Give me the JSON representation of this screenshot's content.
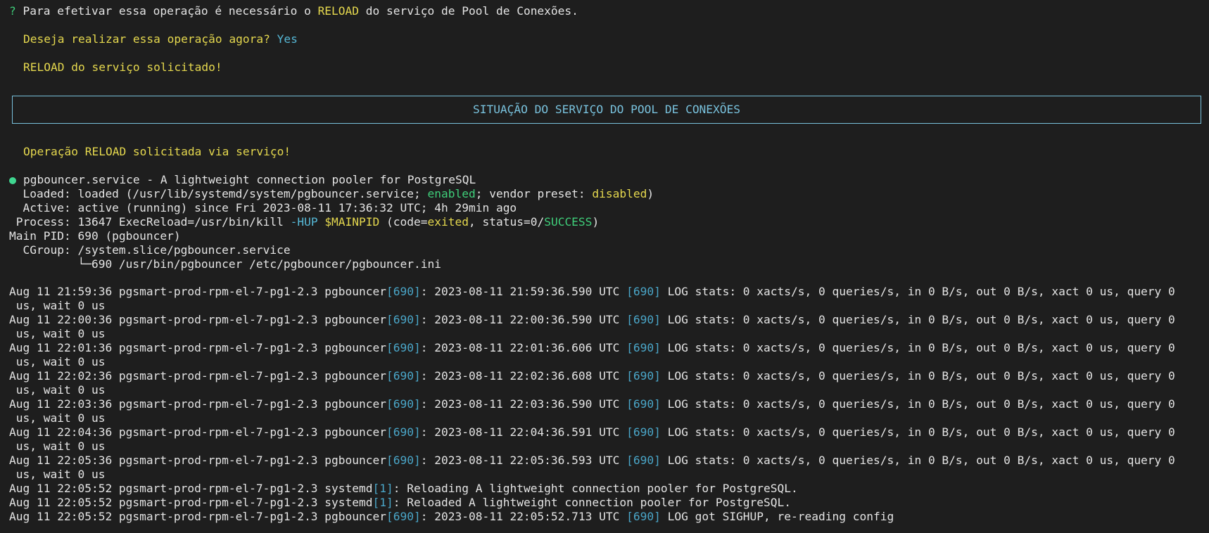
{
  "prompt": {
    "mark": "?",
    "text_before": " Para efetivar essa operação é necessário o ",
    "reload": "RELOAD",
    "text_after": " do serviço de Pool de Conexões."
  },
  "question": {
    "text": "Deseja realizar essa operação agora?",
    "answer": "Yes"
  },
  "reload_requested": "RELOAD do serviço solicitado!",
  "status_box_title": "SITUAÇÃO DO SERVIÇO DO POOL DE CONEXÕES",
  "operation_message": "Operação RELOAD solicitada via serviço!",
  "service": {
    "header": "pgbouncer.service - A lightweight connection pooler for PostgreSQL",
    "loaded_prefix": "  Loaded: loaded (/usr/lib/systemd/system/pgbouncer.service; ",
    "loaded_enabled": "enabled",
    "loaded_mid": "; vendor preset: ",
    "loaded_disabled": "disabled",
    "loaded_suffix": ")",
    "active": "  Active: active (running) since Fri 2023-08-11 17:36:32 UTC; 4h 29min ago",
    "process_prefix": " Process: 13647 ExecReload=/usr/bin/kill ",
    "process_hup": "-HUP",
    "process_space": " ",
    "process_mainpid": "$MAINPID",
    "process_code": " (code=",
    "process_exited": "exited",
    "process_status": ", status=0/",
    "process_success": "SUCCESS",
    "process_end": ")",
    "main_pid": "Main PID: 690 (pgbouncer)",
    "cgroup": "  CGroup: /system.slice/pgbouncer.service",
    "cgroup_child": "          └─690 /usr/bin/pgbouncer /etc/pgbouncer/pgbouncer.ini"
  },
  "logs": [
    {
      "prefix": "Aug 11 21:59:36 pgsmart-prod-rpm-el-7-pg1-2.3 pgbouncer",
      "pid": "[690]",
      "mid": ": 2023-08-11 21:59:36.590 UTC ",
      "pid2": "[690]",
      "msg": " LOG stats: 0 xacts/s, 0 queries/s, in 0 B/s, out 0 B/s, xact 0 us, query 0",
      "wrap": " us, wait 0 us"
    },
    {
      "prefix": "Aug 11 22:00:36 pgsmart-prod-rpm-el-7-pg1-2.3 pgbouncer",
      "pid": "[690]",
      "mid": ": 2023-08-11 22:00:36.590 UTC ",
      "pid2": "[690]",
      "msg": " LOG stats: 0 xacts/s, 0 queries/s, in 0 B/s, out 0 B/s, xact 0 us, query 0",
      "wrap": " us, wait 0 us"
    },
    {
      "prefix": "Aug 11 22:01:36 pgsmart-prod-rpm-el-7-pg1-2.3 pgbouncer",
      "pid": "[690]",
      "mid": ": 2023-08-11 22:01:36.606 UTC ",
      "pid2": "[690]",
      "msg": " LOG stats: 0 xacts/s, 0 queries/s, in 0 B/s, out 0 B/s, xact 0 us, query 0",
      "wrap": " us, wait 0 us"
    },
    {
      "prefix": "Aug 11 22:02:36 pgsmart-prod-rpm-el-7-pg1-2.3 pgbouncer",
      "pid": "[690]",
      "mid": ": 2023-08-11 22:02:36.608 UTC ",
      "pid2": "[690]",
      "msg": " LOG stats: 0 xacts/s, 0 queries/s, in 0 B/s, out 0 B/s, xact 0 us, query 0",
      "wrap": " us, wait 0 us"
    },
    {
      "prefix": "Aug 11 22:03:36 pgsmart-prod-rpm-el-7-pg1-2.3 pgbouncer",
      "pid": "[690]",
      "mid": ": 2023-08-11 22:03:36.590 UTC ",
      "pid2": "[690]",
      "msg": " LOG stats: 0 xacts/s, 0 queries/s, in 0 B/s, out 0 B/s, xact 0 us, query 0",
      "wrap": " us, wait 0 us"
    },
    {
      "prefix": "Aug 11 22:04:36 pgsmart-prod-rpm-el-7-pg1-2.3 pgbouncer",
      "pid": "[690]",
      "mid": ": 2023-08-11 22:04:36.591 UTC ",
      "pid2": "[690]",
      "msg": " LOG stats: 0 xacts/s, 0 queries/s, in 0 B/s, out 0 B/s, xact 0 us, query 0",
      "wrap": " us, wait 0 us"
    },
    {
      "prefix": "Aug 11 22:05:36 pgsmart-prod-rpm-el-7-pg1-2.3 pgbouncer",
      "pid": "[690]",
      "mid": ": 2023-08-11 22:05:36.593 UTC ",
      "pid2": "[690]",
      "msg": " LOG stats: 0 xacts/s, 0 queries/s, in 0 B/s, out 0 B/s, xact 0 us, query 0",
      "wrap": " us, wait 0 us"
    },
    {
      "prefix": "Aug 11 22:05:52 pgsmart-prod-rpm-el-7-pg1-2.3 systemd",
      "pid": "[1]",
      "mid": ": Reloading A lightweight connection pooler for PostgreSQL.",
      "pid2": "",
      "msg": "",
      "wrap": ""
    },
    {
      "prefix": "Aug 11 22:05:52 pgsmart-prod-rpm-el-7-pg1-2.3 systemd",
      "pid": "[1]",
      "mid": ": Reloaded A lightweight connection pooler for PostgreSQL.",
      "pid2": "",
      "msg": "",
      "wrap": ""
    },
    {
      "prefix": "Aug 11 22:05:52 pgsmart-prod-rpm-el-7-pg1-2.3 pgbouncer",
      "pid": "[690]",
      "mid": ": 2023-08-11 22:05:52.713 UTC ",
      "pid2": "[690]",
      "msg": " LOG got SIGHUP, re-reading config",
      "wrap": ""
    }
  ],
  "colors": {
    "background": "#1e1e1e",
    "text": "#e4e4e4",
    "yellow": "#e5d84e",
    "cyan": "#56b8d6",
    "green": "#3fcf7a",
    "box_border": "#79c2dd",
    "status_dot": "#3fd690"
  }
}
